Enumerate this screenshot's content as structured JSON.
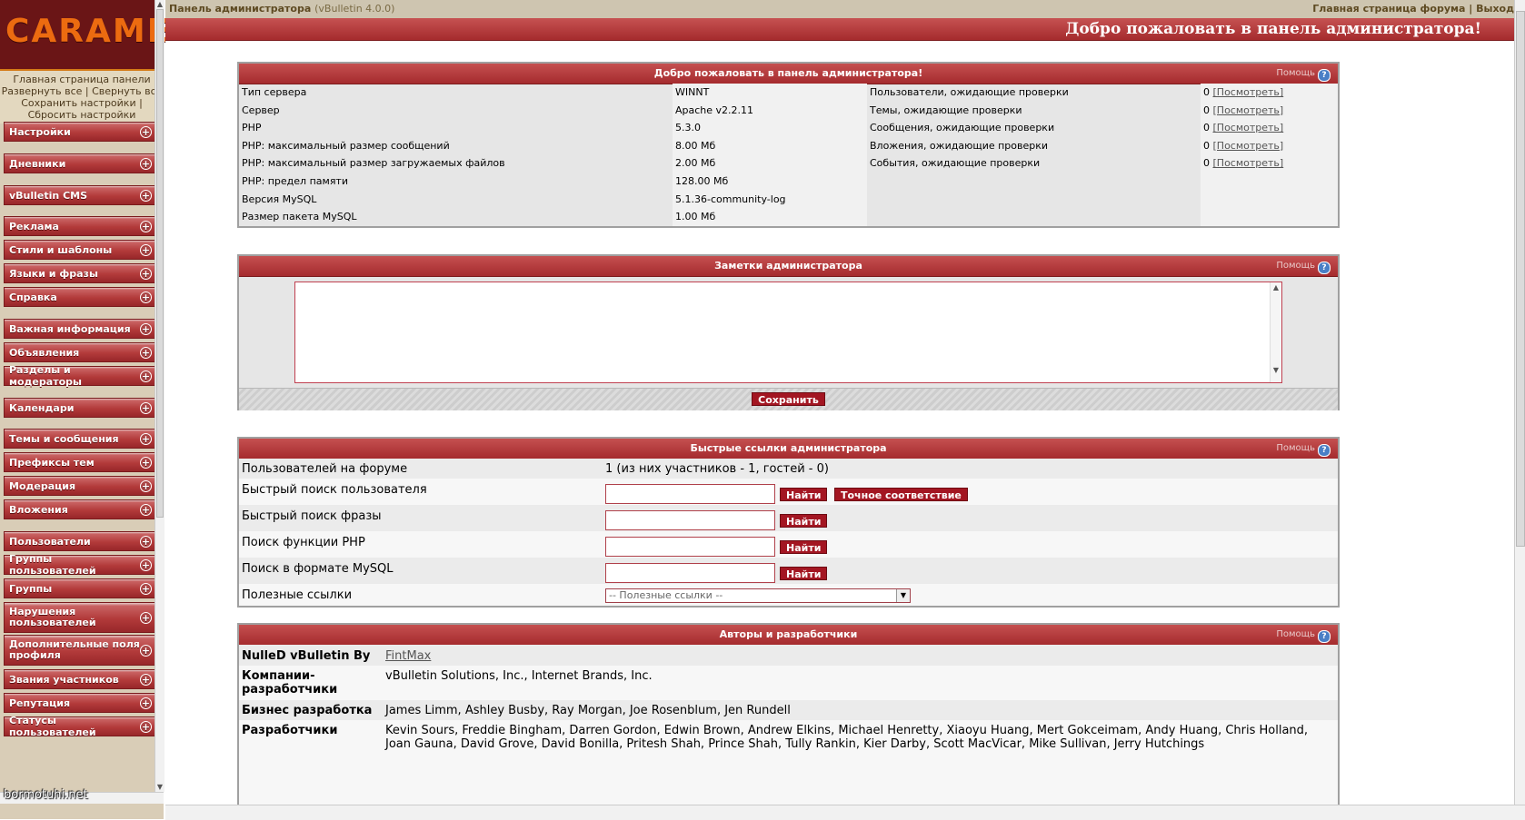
{
  "nav": {
    "logo": "CARAMEL",
    "links": [
      "Главная страница панели",
      "Развернуть все",
      "Свернуть все",
      "Сохранить настройки",
      "Сбросить настройки"
    ],
    "groups": [
      "Настройки",
      "Дневники",
      "vBulletin CMS",
      "Реклама",
      "Стили и шаблоны",
      "Языки и фразы",
      "Справка",
      "Важная информация",
      "Объявления",
      "Разделы и модераторы",
      "Календари",
      "Темы и сообщения",
      "Префиксы тем",
      "Модерация",
      "Вложения",
      "Пользователи",
      "Группы пользователей",
      "Группы",
      "Нарушения пользователей",
      "Дополнительные поля профиля",
      "Звания участников",
      "Репутация",
      "Статусы пользователей"
    ],
    "watermark": "bormotuhi.net"
  },
  "topbar": {
    "title": "Панель администратора",
    "version": "(vBulletin 4.0.0)",
    "forum_home": "Главная страница форума",
    "sep": "|",
    "logout": "Выход"
  },
  "welcome": "Добро пожаловать в панель администратора!",
  "help": "Помощь",
  "system_panel": {
    "title": "Добро пожаловать в панель администратора!",
    "rows": [
      {
        "k": "Тип сервера",
        "v": "WINNT"
      },
      {
        "k": "Сервер",
        "v": "Apache v2.2.11"
      },
      {
        "k": "PHP",
        "v": "5.3.0"
      },
      {
        "k": "PHP: максимальный размер сообщений",
        "v": "8.00 Мб"
      },
      {
        "k": "PHP: максимальный размер загружаемых файлов",
        "v": "2.00 Мб"
      },
      {
        "k": "PHP: предел памяти",
        "v": "128.00 Мб"
      },
      {
        "k": "Версия MySQL",
        "v": "5.1.36-community-log"
      },
      {
        "k": "Размер пакета MySQL",
        "v": "1.00 Мб"
      }
    ],
    "moderation": [
      {
        "k": "Пользователи, ожидающие проверки",
        "count": "0",
        "link": "[Посмотреть]"
      },
      {
        "k": "Темы, ожидающие проверки",
        "count": "0",
        "link": "[Посмотреть]"
      },
      {
        "k": "Сообщения, ожидающие проверки",
        "count": "0",
        "link": "[Посмотреть]"
      },
      {
        "k": "Вложения, ожидающие проверки",
        "count": "0",
        "link": "[Посмотреть]"
      },
      {
        "k": "События, ожидающие проверки",
        "count": "0",
        "link": "[Посмотреть]"
      }
    ]
  },
  "notes_panel": {
    "title": "Заметки администратора",
    "value": "",
    "save": "Сохранить"
  },
  "quick_panel": {
    "title": "Быстрые ссылки администратора",
    "online_label": "Пользователей на форуме",
    "online_value": "1 (из них участников - 1, гостей - 0)",
    "user_search": "Быстрый поиск пользователя",
    "phrase_search": "Быстрый поиск фразы",
    "php_search": "Поиск функции PHP",
    "mysql_search": "Поиск в формате MySQL",
    "find": "Найти",
    "exact": "Точное соответствие",
    "useful_label": "Полезные ссылки",
    "useful_selected": "-- Полезные ссылки --"
  },
  "credits_panel": {
    "title": "Авторы и разработчики",
    "rows": [
      {
        "k": "NulleD vBulletin By",
        "v": "FintMax"
      },
      {
        "k": "Компании-разработчики",
        "v": "vBulletin Solutions, Inc., Internet Brands, Inc."
      },
      {
        "k": "Бизнес разработка",
        "v": "James Limm, Ashley Busby, Ray Morgan, Joe Rosenblum, Jen Rundell"
      },
      {
        "k": "Разработчики",
        "v": "Kevin Sours, Freddie Bingham, Darren Gordon, Edwin Brown, Andrew Elkins, Michael Henretty, Xiaoyu Huang, Mert Gokceimam, Andy Huang, Chris Holland, Joan Gauna, David Grove, David Bonilla, Pritesh Shah, Prince Shah, Tully Rankin, Kier Darby, Scott MacVicar, Mike Sullivan, Jerry Hutchings"
      }
    ]
  }
}
